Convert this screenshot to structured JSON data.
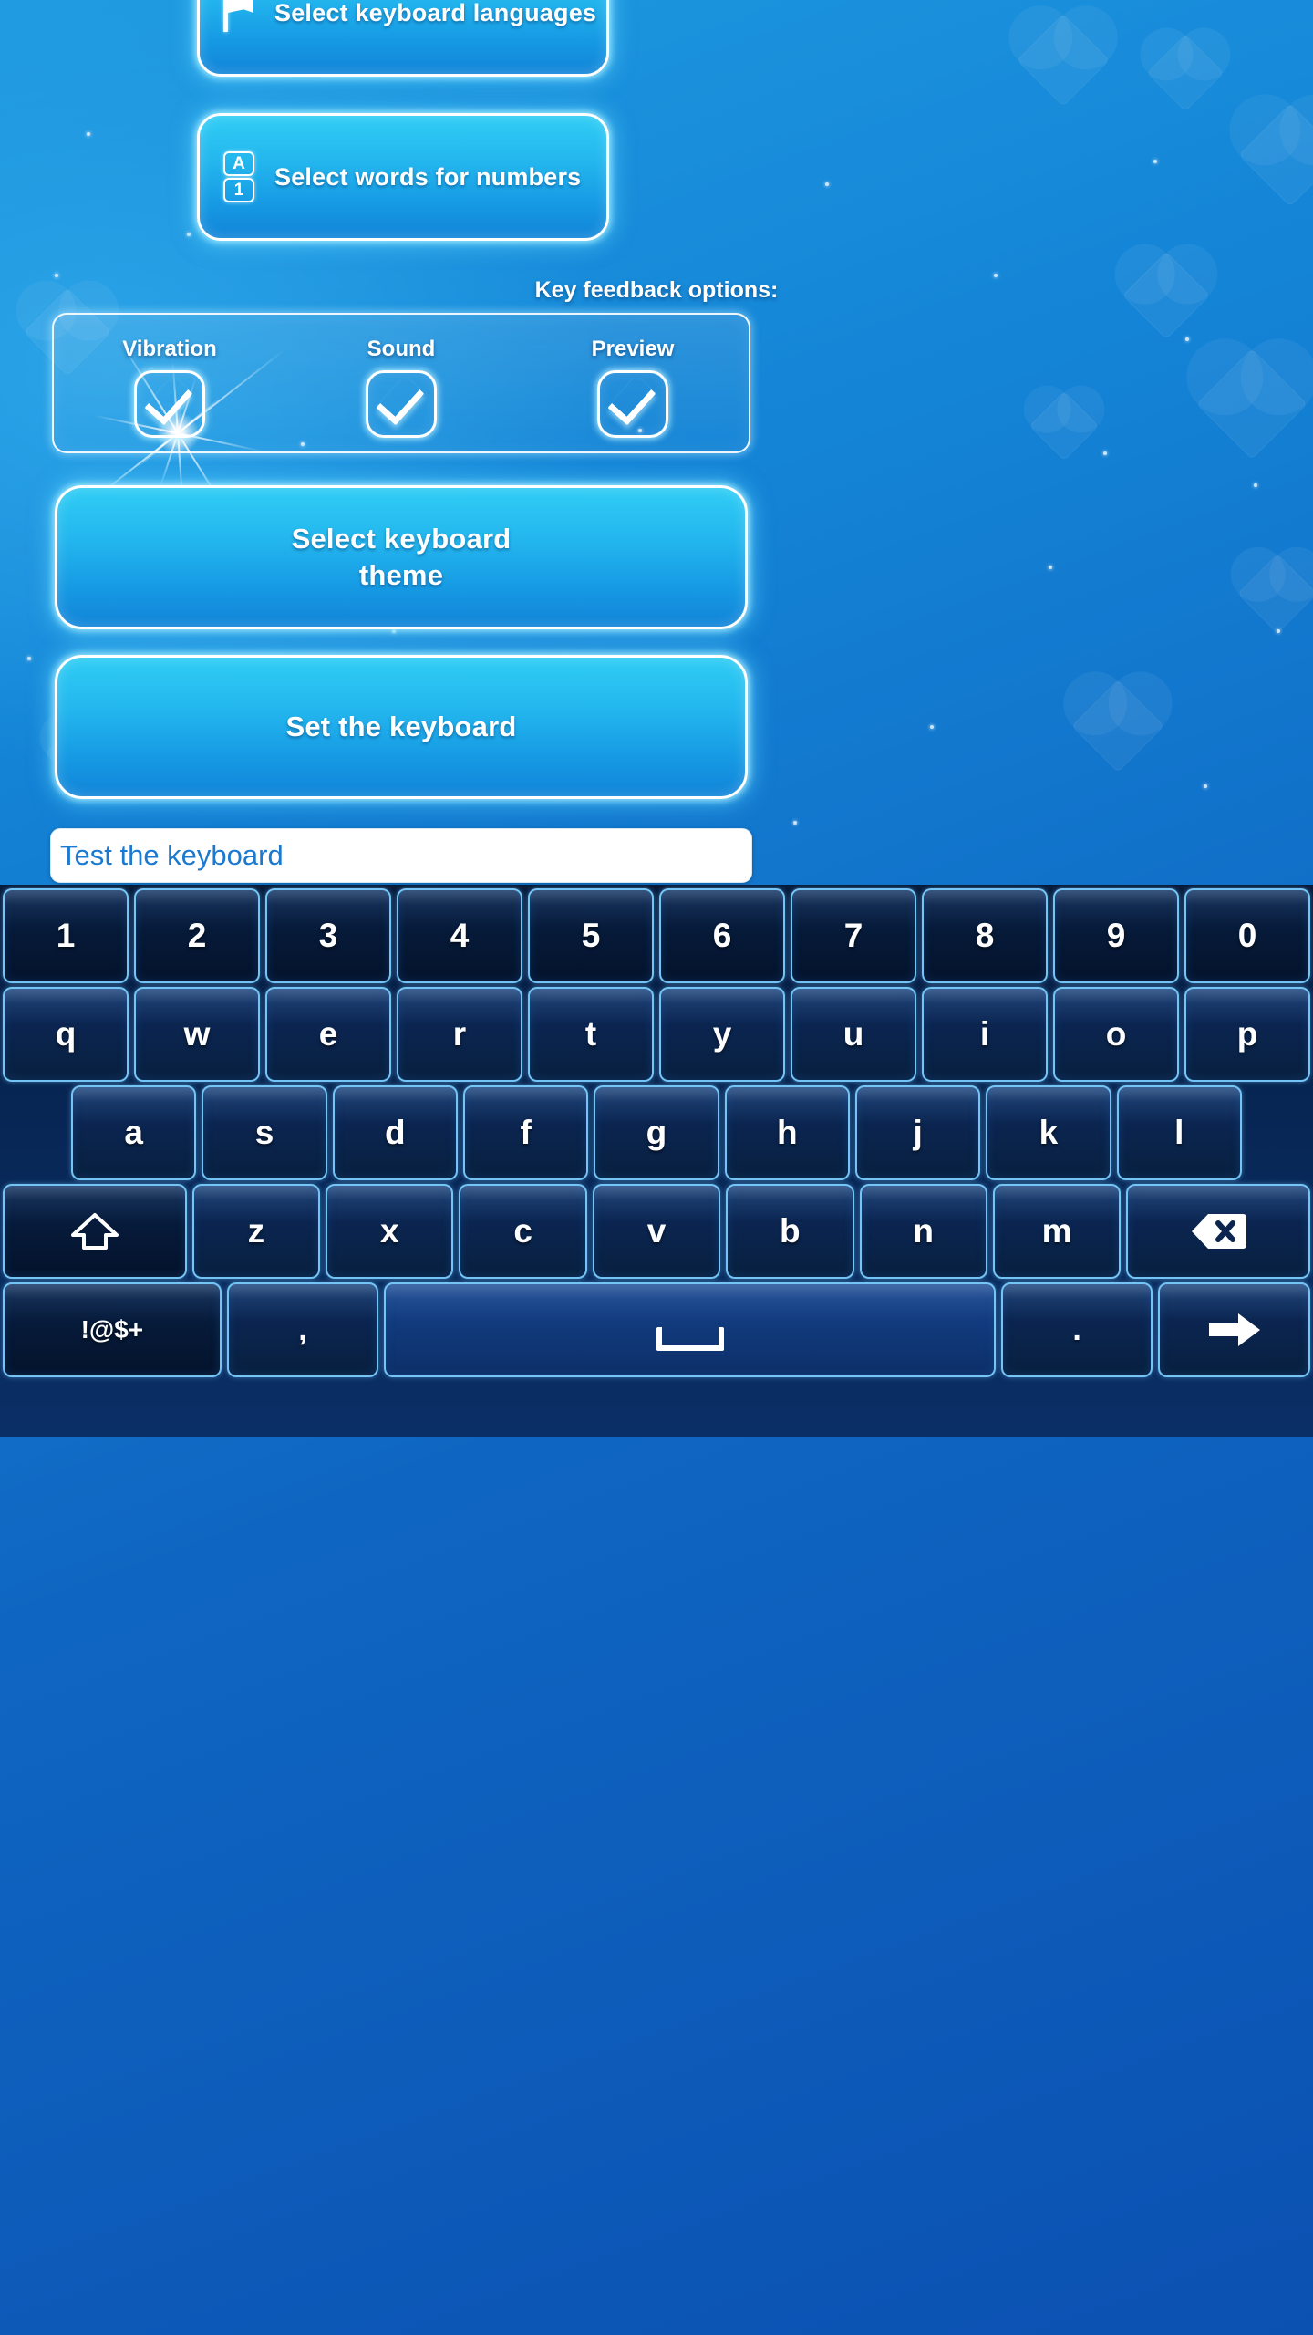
{
  "theme": {
    "accent_cyan": "#30cdf5",
    "accent_blue": "#1484d6",
    "neon_border": "#ffffff",
    "keyboard_bg": "#082a5c",
    "key_border": "#74c4f5",
    "input_text": "#1b79d0"
  },
  "buttons": {
    "languages": {
      "label": "Select keyboard languages",
      "icon": "flag-icon"
    },
    "numbers": {
      "label": "Select words for numbers",
      "icon": "letter-number-icon",
      "icon_top": "A",
      "icon_bottom": "1"
    },
    "theme": {
      "line1": "Select keyboard",
      "line2": "theme"
    },
    "set": {
      "label": "Set the keyboard"
    }
  },
  "feedback": {
    "title": "Key feedback options:",
    "options": [
      {
        "label": "Vibration",
        "checked": true
      },
      {
        "label": "Sound",
        "checked": true
      },
      {
        "label": "Preview",
        "checked": true
      }
    ]
  },
  "test_field": {
    "placeholder": "Test the keyboard",
    "value": ""
  },
  "keyboard": {
    "rows": {
      "numbers": [
        "1",
        "2",
        "3",
        "4",
        "5",
        "6",
        "7",
        "8",
        "9",
        "0"
      ],
      "qwerty": [
        "q",
        "w",
        "e",
        "r",
        "t",
        "y",
        "u",
        "i",
        "o",
        "p"
      ],
      "asdf": [
        "a",
        "s",
        "d",
        "f",
        "g",
        "h",
        "j",
        "k",
        "l"
      ],
      "zxcv": [
        "z",
        "x",
        "c",
        "v",
        "b",
        "n",
        "m"
      ]
    },
    "shift_key": {
      "name": "shift-key",
      "glyph": "shift-arrow-icon"
    },
    "backspace_key": {
      "name": "backspace-key",
      "glyph": "backspace-icon"
    },
    "symbols_key": {
      "name": "symbols-key",
      "label": "!@$+"
    },
    "comma_key": {
      "name": "comma-key",
      "label": ","
    },
    "space_key": {
      "name": "space-key",
      "glyph": "space-bar-icon"
    },
    "period_key": {
      "name": "period-key",
      "label": "."
    },
    "enter_key": {
      "name": "enter-key",
      "glyph": "arrow-right-icon"
    }
  }
}
